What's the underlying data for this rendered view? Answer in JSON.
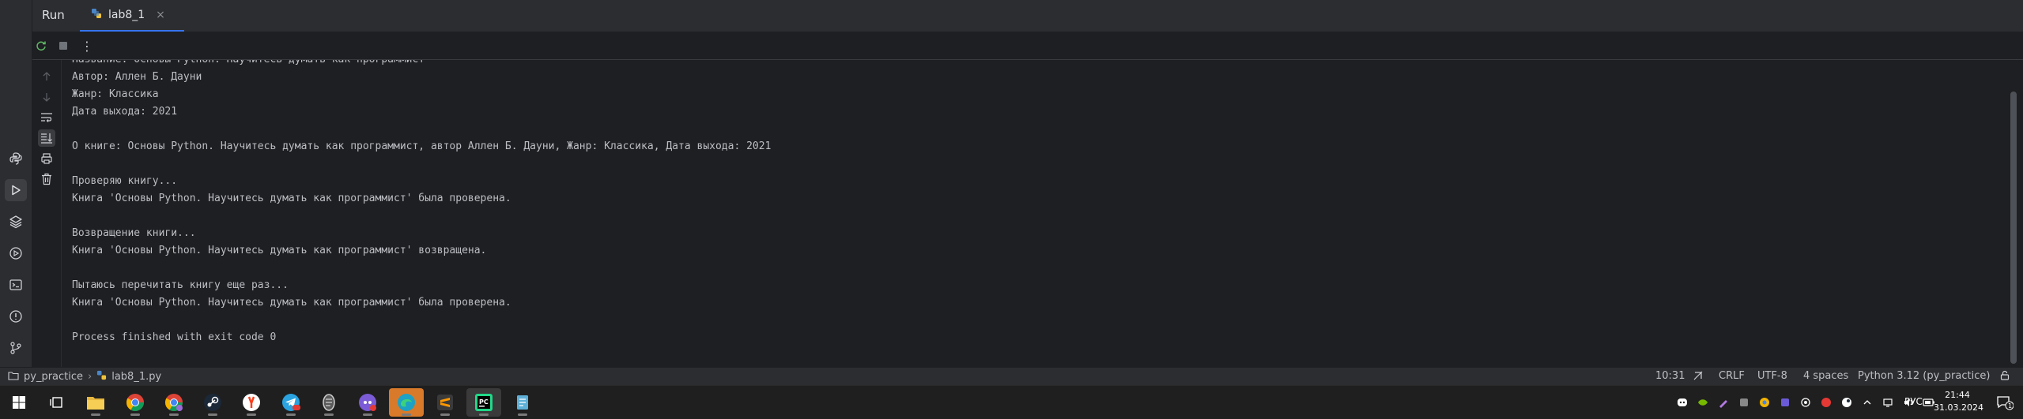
{
  "toolwindow": {
    "title": "Run"
  },
  "tab": {
    "label": "lab8_1",
    "close": "×"
  },
  "toolbar": {
    "more": "⋮"
  },
  "console": {
    "lines": [
      "Название: Основы Python. Научитесь думать как программист",
      "Автор: Аллен Б. Дауни",
      "Жанр: Классика",
      "Дата выхода: 2021",
      "",
      "О книге: Основы Python. Научитесь думать как программист, автор Аллен Б. Дауни, Жанр: Классика, Дата выхода: 2021",
      "",
      "Проверяю книгу...",
      "Книга 'Основы Python. Научитесь думать как программист' была проверена.",
      "",
      "Возвращение книги...",
      "Книга 'Основы Python. Научитесь думать как программист' возвращена.",
      "",
      "Пытаюсь перечитать книгу еще раз...",
      "Книга 'Основы Python. Научитесь думать как программист' была проверена.",
      "",
      "Process finished with exit code 0"
    ]
  },
  "statusbar": {
    "project": "py_practice",
    "separator": "›",
    "file": "lab8_1.py",
    "position": "10:31",
    "line_separator": "CRLF",
    "encoding": "UTF-8",
    "indent": "4 spaces",
    "interpreter": "Python 3.12 (py_practice)"
  },
  "taskbar": {
    "language": "РУС",
    "time": "21:44",
    "date": "31.03.2024",
    "notification_count": "1"
  },
  "colors": {
    "accent": "#3574f0",
    "background": "#1e1f22",
    "panel": "#2b2d30",
    "text": "#bcbec4"
  }
}
